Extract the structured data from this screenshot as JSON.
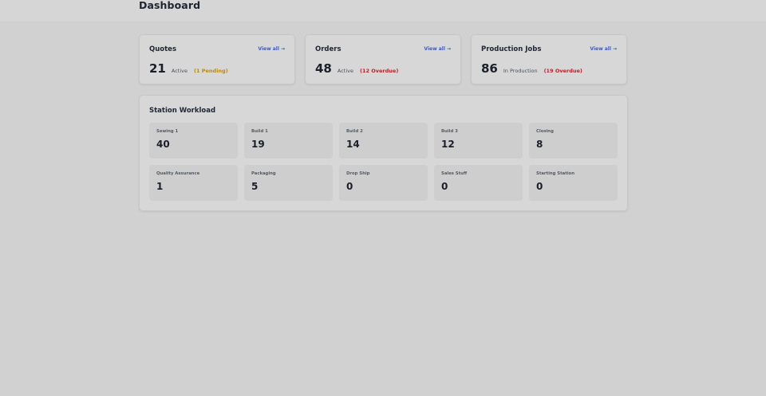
{
  "header": {
    "title": "Dashboard"
  },
  "summary_cards": [
    {
      "title": "Quotes",
      "link_label": "View all →",
      "value": "21",
      "label": "Active",
      "note": "(1 Pending)",
      "note_color": "#b58a1f"
    },
    {
      "title": "Orders",
      "link_label": "View all →",
      "value": "48",
      "label": "Active",
      "note": "(12 Overdue)",
      "note_color": "#b3262d"
    },
    {
      "title": "Production Jobs",
      "link_label": "View all →",
      "value": "86",
      "label": "In Production",
      "note": "(19 Overdue)",
      "note_color": "#b3262d"
    }
  ],
  "workload": {
    "title": "Station Workload",
    "stations": [
      {
        "name": "Sewing 1",
        "count": "40"
      },
      {
        "name": "Build 1",
        "count": "19"
      },
      {
        "name": "Build 2",
        "count": "14"
      },
      {
        "name": "Build 3",
        "count": "12"
      },
      {
        "name": "Closing",
        "count": "8"
      },
      {
        "name": "Quality Assurance",
        "count": "1"
      },
      {
        "name": "Packaging",
        "count": "5"
      },
      {
        "name": "Drop Ship",
        "count": "0"
      },
      {
        "name": "Sales Stuff",
        "count": "0"
      },
      {
        "name": "Starting Station",
        "count": "0"
      }
    ]
  },
  "colors": {
    "link": "#3f5cb8",
    "pending": "#b58a1f",
    "overdue": "#b3262d"
  }
}
